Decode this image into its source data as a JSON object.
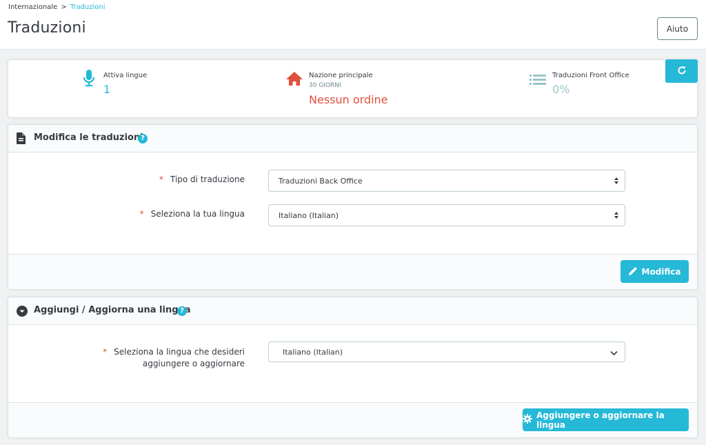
{
  "breadcrumb": {
    "parent": "Internazionale",
    "separator": ">",
    "current": "Traduzioni"
  },
  "header": {
    "title": "Traduzioni",
    "help_label": "Aiuto"
  },
  "kpis": [
    {
      "icon": "microphone-icon",
      "label": "Attiva lingue",
      "subtitle": "",
      "value": "1",
      "color": "#25b9d7"
    },
    {
      "icon": "home-icon",
      "label": "Nazione principale",
      "subtitle": "30 GIORNI",
      "value": "Nessun ordine",
      "color": "#e04f3c"
    },
    {
      "icon": "list-icon",
      "label": "Traduzioni Front Office",
      "subtitle": "",
      "value": "0%",
      "color": "#99c5c9"
    }
  ],
  "refresh": {
    "icon": "refresh-icon"
  },
  "modify_panel": {
    "title": "Modifica le traduzioni",
    "help": "?",
    "fields": [
      {
        "label": "Tipo di traduzione",
        "value": "Traduzioni Back Office"
      },
      {
        "label": "Seleziona la tua lingua",
        "value": "Italiano (Italian)"
      }
    ],
    "required_mark": "*",
    "submit_label": "Modifica"
  },
  "add_panel": {
    "title": "Aggiungi / Aggiorna una lingua",
    "help": "?",
    "field_label_line1": "Seleziona la lingua che desideri",
    "field_label_line2": "aggiungere o aggiornare",
    "field_value": "Italiano (Italian)",
    "required_mark": "*",
    "submit_label": "Aggiungere o aggiornare la lingua"
  },
  "colors": {
    "accent": "#25b9d7",
    "danger": "#e04f3c",
    "text": "#363a41"
  }
}
